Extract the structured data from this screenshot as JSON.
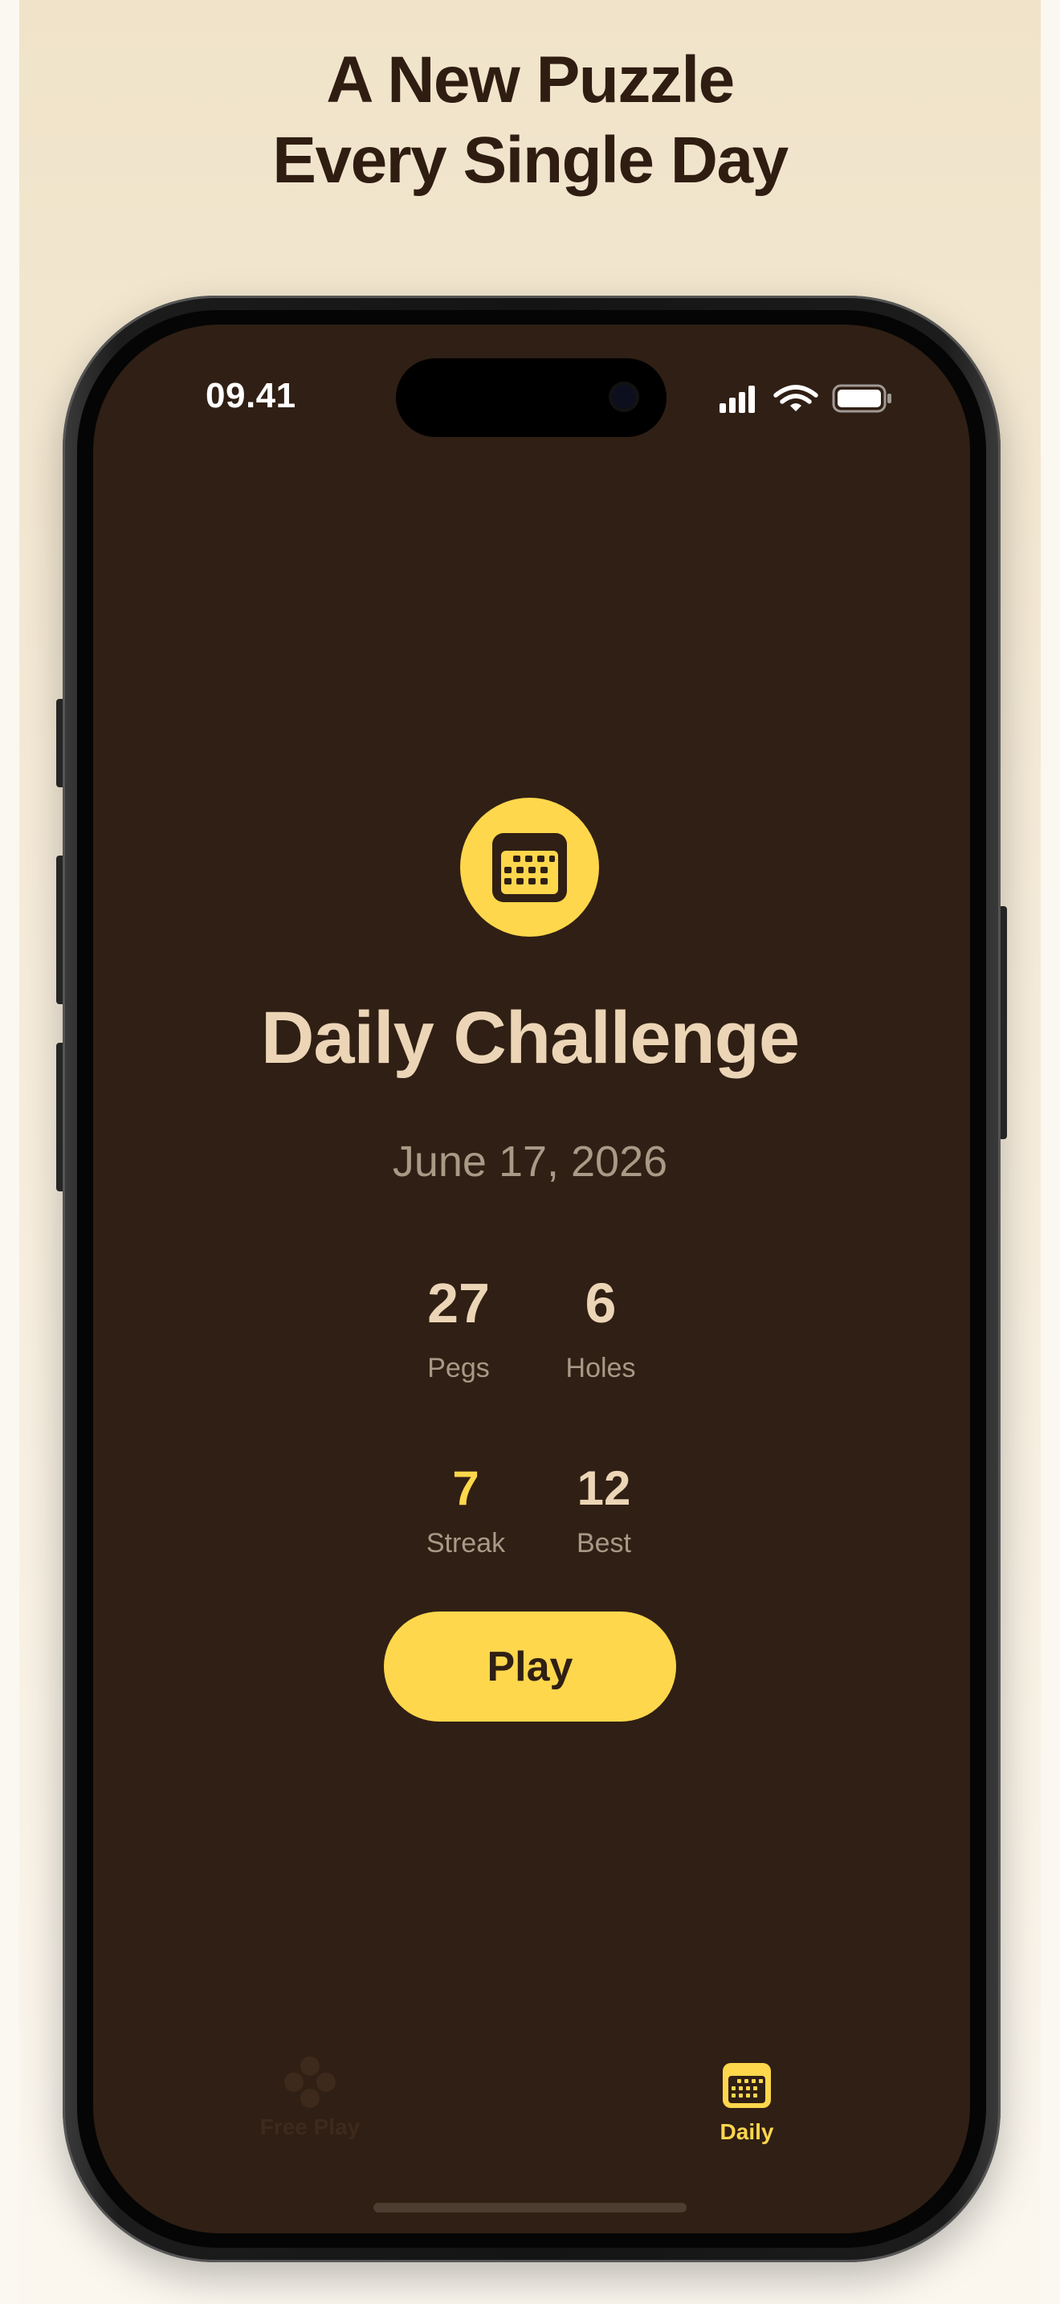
{
  "marketing": {
    "headline_line1": "A New Puzzle",
    "headline_line2": "Every Single Day"
  },
  "status_bar": {
    "time": "09.41",
    "icons": [
      "cellular-signal-icon",
      "wifi-icon",
      "battery-icon"
    ]
  },
  "daily": {
    "icon": "calendar-icon",
    "title": "Daily Challenge",
    "date": "June 17, 2026",
    "stats": {
      "pegs_value": "27",
      "pegs_label": "Pegs",
      "holes_value": "6",
      "holes_label": "Holes",
      "streak_value": "7",
      "streak_label": "Streak",
      "best_value": "12",
      "best_label": "Best"
    },
    "play_label": "Play"
  },
  "tab_bar": {
    "tabs": [
      {
        "label": "Free Play",
        "icon": "pegs-icon",
        "selected": false
      },
      {
        "label": "Daily",
        "icon": "calendar-icon",
        "selected": true
      }
    ]
  },
  "colors": {
    "background": "#301f14",
    "accent": "#fed74c",
    "primary_text": "#ecd5b6",
    "secondary_text": "#a79a86",
    "inactive_tab": "#3d2a1d"
  }
}
